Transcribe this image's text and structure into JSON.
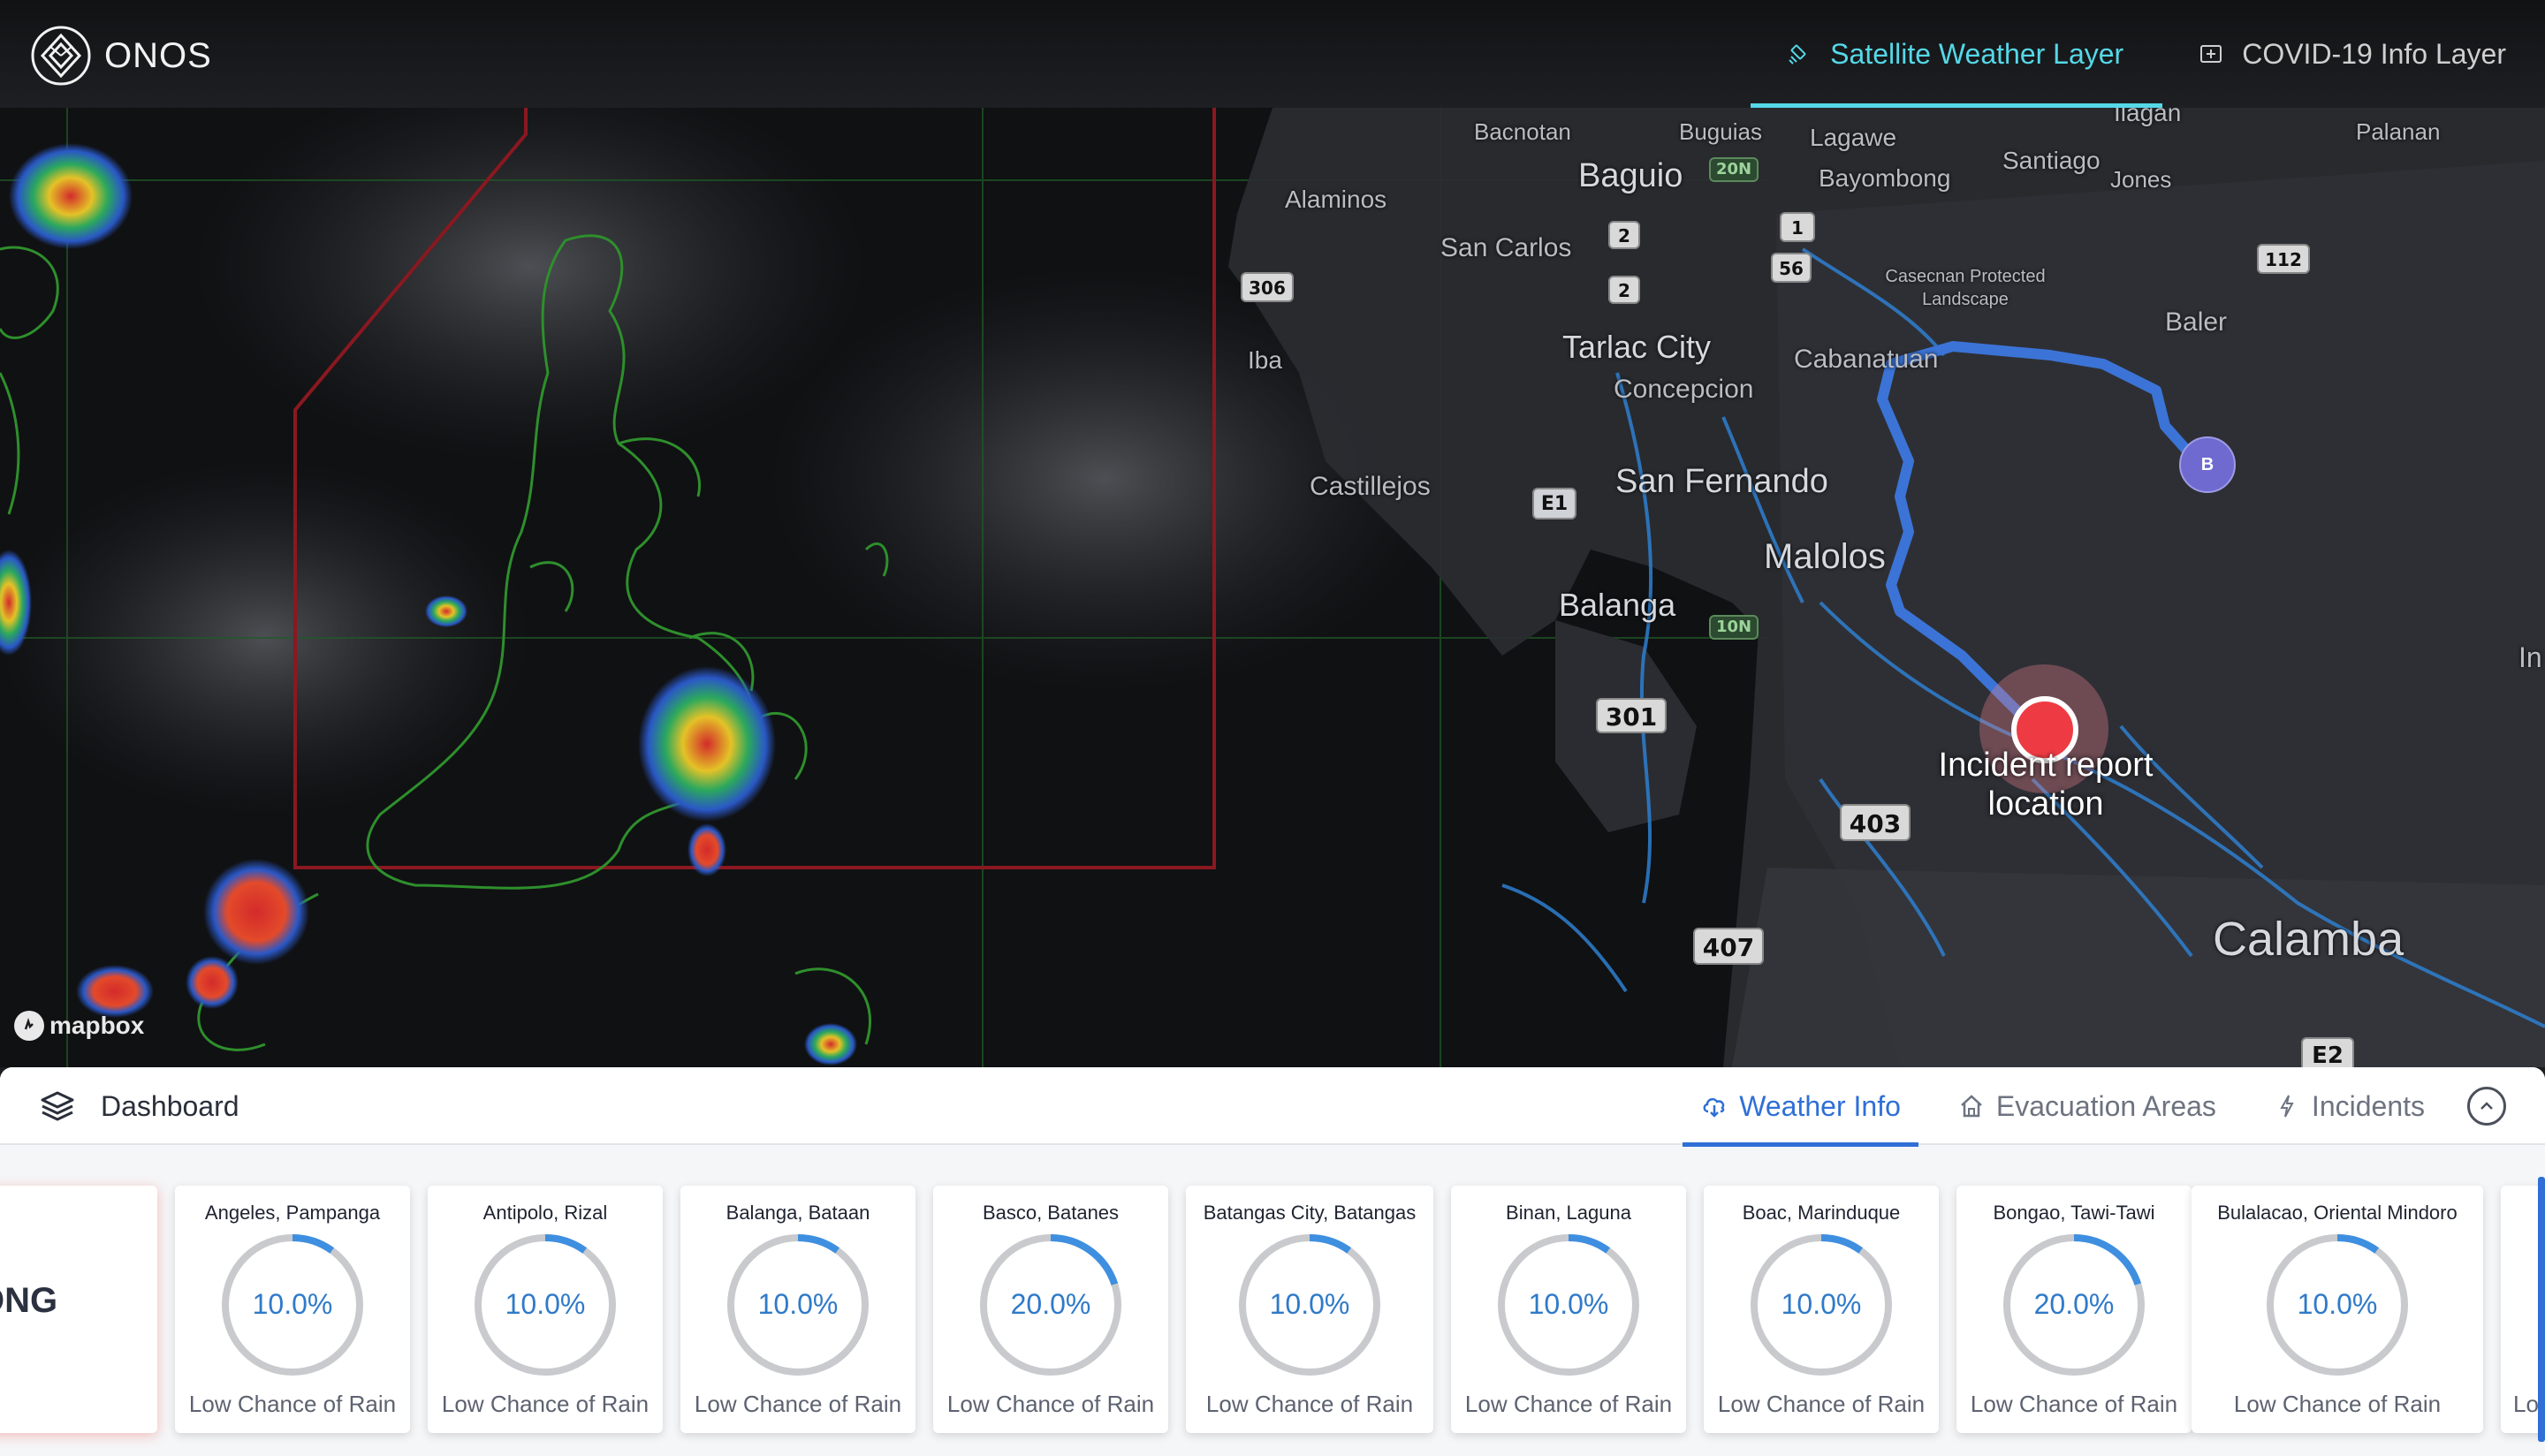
{
  "app": {
    "name": "ONOS"
  },
  "header": {
    "layers": [
      {
        "label": "Satellite Weather Layer",
        "icon": "satellite-icon",
        "active": true
      },
      {
        "label": "COVID-19 Info Layer",
        "icon": "covid-info-icon",
        "active": false
      }
    ],
    "accent_color": "#55d8e8"
  },
  "map": {
    "attribution": "mapbox",
    "places": {
      "bacnotan": "Bacnotan",
      "buguias": "Buguias",
      "lagawe": "Lagawe",
      "ilagan": "Ilagan",
      "palanan": "Palanan",
      "baguio": "Baguio",
      "bayombong": "Bayombong",
      "santiago": "Santiago",
      "jones": "Jones",
      "alaminos": "Alaminos",
      "san_carlos": "San Carlos",
      "casecnan": "Casecnan Protected Landscape",
      "baler": "Baler",
      "iba": "Iba",
      "tarlac_city": "Tarlac City",
      "cabanatuan": "Cabanatuan",
      "concepcion": "Concepcion",
      "castillejos": "Castillejos",
      "san_fernando": "San Fernando",
      "malolos": "Malolos",
      "balanga": "Balanga",
      "calamba": "Calamba",
      "in": "In"
    },
    "routes": {
      "r20n": "20N",
      "r1": "1",
      "r2a": "2",
      "r2b": "2",
      "r56": "56",
      "r112": "112",
      "r306": "306",
      "re1": "E1",
      "r10n": "10N",
      "r301": "301",
      "r403": "403",
      "r407": "407",
      "re2": "E2"
    },
    "marker_b": "B",
    "incident_label": "Incident report location"
  },
  "dashboard": {
    "title": "Dashboard",
    "tabs": [
      {
        "label": "Weather Info",
        "icon": "cloud-download-icon",
        "active": true
      },
      {
        "label": "Evacuation Areas",
        "icon": "house-icon",
        "active": false
      },
      {
        "label": "Incidents",
        "icon": "bolt-icon",
        "active": false
      }
    ],
    "feature_card_text": "ONG",
    "accent_color": "#2f6fd6",
    "weather_cards": [
      {
        "city": "Angeles, Pampanga",
        "percent_label": "10.0%",
        "percent": 10,
        "description": "Low Chance of Rain"
      },
      {
        "city": "Antipolo, Rizal",
        "percent_label": "10.0%",
        "percent": 10,
        "description": "Low Chance of Rain"
      },
      {
        "city": "Balanga, Bataan",
        "percent_label": "10.0%",
        "percent": 10,
        "description": "Low Chance of Rain"
      },
      {
        "city": "Basco, Batanes",
        "percent_label": "20.0%",
        "percent": 20,
        "description": "Low Chance of Rain"
      },
      {
        "city": "Batangas City, Batangas",
        "percent_label": "10.0%",
        "percent": 10,
        "description": "Low Chance of Rain"
      },
      {
        "city": "Binan, Laguna",
        "percent_label": "10.0%",
        "percent": 10,
        "description": "Low Chance of Rain"
      },
      {
        "city": "Boac, Marinduque",
        "percent_label": "10.0%",
        "percent": 10,
        "description": "Low Chance of Rain"
      },
      {
        "city": "Bongao, Tawi-Tawi",
        "percent_label": "20.0%",
        "percent": 20,
        "description": "Low Chance of Rain"
      },
      {
        "city": "Bulalacao, Oriental Mindoro",
        "percent_label": "10.0%",
        "percent": 10,
        "description": "Low Chance of Rain"
      },
      {
        "city": "",
        "percent_label": "",
        "percent": 0,
        "description": "Lo"
      }
    ]
  }
}
